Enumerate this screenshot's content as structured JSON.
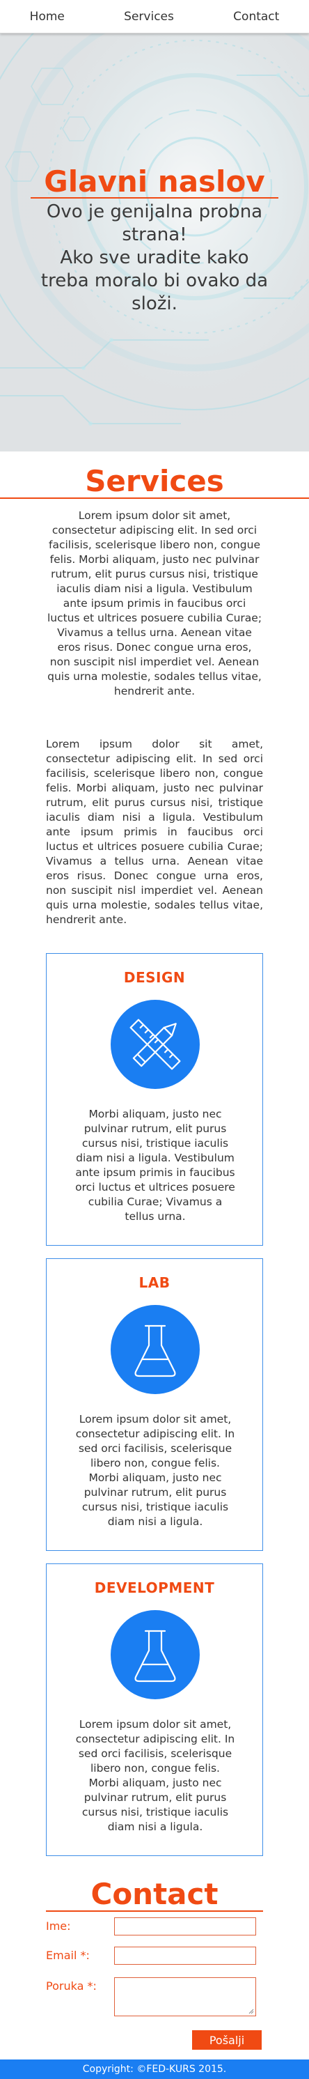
{
  "nav": {
    "items": [
      {
        "label": "Home"
      },
      {
        "label": "Services"
      },
      {
        "label": "Contact"
      }
    ]
  },
  "hero": {
    "title": "Glavni naslov",
    "lines": [
      "Ovo je genijalna probna",
      "strana!",
      "Ako sve uradite kako",
      "treba moralo bi ovako da",
      "složi."
    ]
  },
  "services": {
    "title": "Services",
    "paragraph_centered": "Lorem ipsum dolor sit amet, consectetur adipiscing elit. In sed orci facilisis, scelerisque libero non, congue felis. Morbi aliquam, justo nec pulvinar rutrum, elit purus cursus nisi, tristique iaculis diam nisi a ligula. Vestibulum ante ipsum primis in faucibus orci luctus et ultrices posuere cubilia Curae; Vivamus a tellus urna. Aenean vitae eros risus. Donec congue urna eros, non suscipit nisl imperdiet vel. Aenean quis urna molestie, sodales tellus vitae, hendrerit ante.",
    "paragraph_justified": "Lorem ipsum dolor sit amet, consectetur adipiscing elit. In sed orci facilisis, scelerisque libero non, congue felis. Morbi aliquam, justo nec pulvinar rutrum, elit purus cursus nisi, tristique iaculis diam nisi a ligula. Vestibulum ante ipsum primis in faucibus orci luctus et ultrices posuere cubilia Curae; Vivamus a tellus urna. Aenean vitae eros risus. Donec congue urna eros, non suscipit nisl imperdiet vel. Aenean quis urna molestie, sodales tellus vitae, hendrerit ante.",
    "cards": [
      {
        "title": "DESIGN",
        "icon": "pencil-ruler-icon",
        "text": "Morbi aliquam, justo nec pulvinar rutrum, elit purus cursus nisi, tristique iaculis diam nisi a ligula. Vestibulum ante ipsum primis in faucibus orci luctus et ultrices posuere cubilia Curae; Vivamus a tellus urna."
      },
      {
        "title": "LAB",
        "icon": "flask-icon",
        "text": "Lorem ipsum dolor sit amet, consectetur adipiscing elit. In sed orci facilisis, scelerisque libero non, congue felis. Morbi aliquam, justo nec pulvinar rutrum, elit purus cursus nisi, tristique iaculis diam nisi a ligula."
      },
      {
        "title": "DEVELOPMENT",
        "icon": "flask-icon",
        "text": "Lorem ipsum dolor sit amet, consectetur adipiscing elit. In sed orci facilisis, scelerisque libero non, congue felis. Morbi aliquam, justo nec pulvinar rutrum, elit purus cursus nisi, tristique iaculis diam nisi a ligula."
      }
    ]
  },
  "contact": {
    "title": "Contact",
    "name_label": "Ime:",
    "name_value": "",
    "email_label": "Email *:",
    "email_value": "",
    "message_label": "Poruka *:",
    "message_value": "",
    "submit_label": "Pošalji"
  },
  "footer": {
    "text": "Copyright: ©FED-KURS 2015."
  },
  "colors": {
    "accent": "#f04a13",
    "brand_blue": "#1a7ef2",
    "card_border": "#3d8ee8"
  }
}
